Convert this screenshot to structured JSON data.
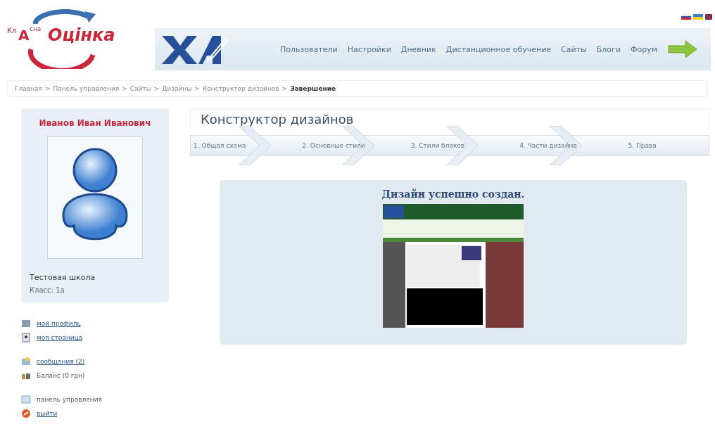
{
  "logo": {
    "parts": [
      "Кл",
      "А",
      "сна"
    ],
    "word": "Оцінка"
  },
  "nav": {
    "items": [
      {
        "label": "Пользователи"
      },
      {
        "label": "Настройки"
      },
      {
        "label": "Дневник"
      },
      {
        "label": "Дистанционное обучение"
      },
      {
        "label": "Сайты"
      },
      {
        "label": "Блоги"
      },
      {
        "label": "Форум"
      }
    ]
  },
  "breadcrumb": {
    "separator": ">",
    "links": [
      "Главная",
      "Панель управления",
      "Сайты",
      "Дизайны",
      "Конструктор дизайнов"
    ],
    "current": "Завершение"
  },
  "profile": {
    "name": "Иванов Иван Иванович",
    "school": "Тестовая школа",
    "class": "Класс: 1а"
  },
  "link_groups": [
    [
      {
        "kind": "profile",
        "label": "мой профиль",
        "link": true
      },
      {
        "kind": "page",
        "label": "моя страница",
        "link": true
      }
    ],
    [
      {
        "kind": "mail",
        "label": "сообщения (2)",
        "link": true
      },
      {
        "kind": "balance",
        "label": "Баланс (0 грн)",
        "link": false
      }
    ],
    [
      {
        "kind": "panel",
        "label": "панель управления",
        "link": false
      },
      {
        "kind": "exit",
        "label": "выйти",
        "link": true
      }
    ]
  ],
  "title": "Конструктор дизайнов",
  "steps": [
    {
      "label": "1. Общая схема"
    },
    {
      "label": "2. Основные стили"
    },
    {
      "label": "3. Стили блоков"
    },
    {
      "label": "4. Части дизайна"
    },
    {
      "label": "5. Права"
    }
  ],
  "result": {
    "message": "Дизайн успешно создан."
  }
}
